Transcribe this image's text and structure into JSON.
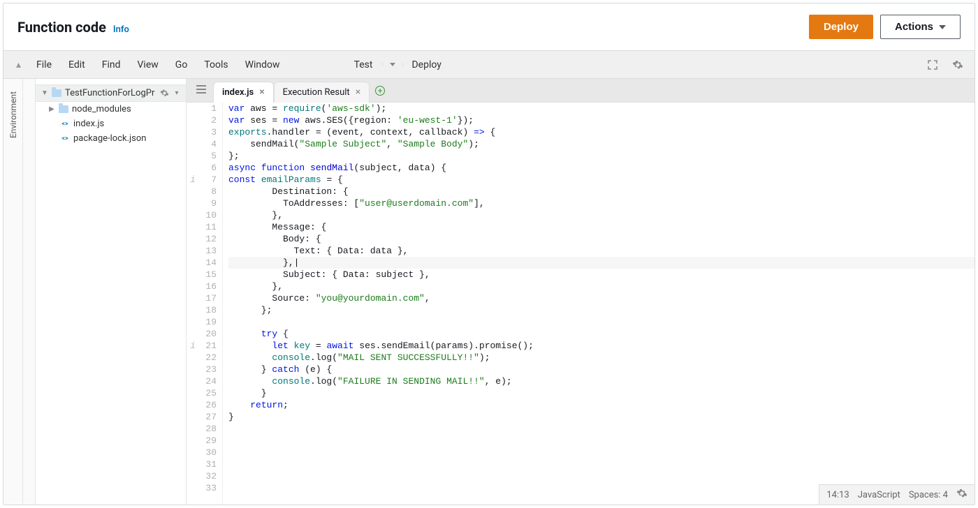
{
  "header": {
    "title": "Function code",
    "info_label": "Info",
    "deploy_label": "Deploy",
    "actions_label": "Actions"
  },
  "menubar": {
    "items": [
      "File",
      "Edit",
      "Find",
      "View",
      "Go",
      "Tools",
      "Window"
    ],
    "test_label": "Test",
    "deploy_label": "Deploy"
  },
  "sidebar": {
    "env_label": "Environment",
    "root": "TestFunctionForLogPr",
    "items": [
      {
        "type": "folder",
        "label": "node_modules"
      },
      {
        "type": "file",
        "label": "index.js"
      },
      {
        "type": "file",
        "label": "package-lock.json"
      }
    ]
  },
  "tabs": [
    {
      "label": "index.js",
      "active": true,
      "closeable": true
    },
    {
      "label": "Execution Result",
      "active": false,
      "closeable": true
    }
  ],
  "code": {
    "info_markers": {
      "7": "i",
      "21": "i"
    },
    "highlighted_line": 14,
    "total_lines": 33,
    "lines": [
      [
        {
          "t": "var",
          "c": "k-blue"
        },
        {
          "t": " aws = "
        },
        {
          "t": "require",
          "c": "k-teal"
        },
        {
          "t": "("
        },
        {
          "t": "'aws-sdk'",
          "c": "k-green"
        },
        {
          "t": ");"
        }
      ],
      [
        {
          "t": "var",
          "c": "k-blue"
        },
        {
          "t": " ses = "
        },
        {
          "t": "new",
          "c": "k-blue"
        },
        {
          "t": " aws.SES({region: "
        },
        {
          "t": "'eu-west-1'",
          "c": "k-green"
        },
        {
          "t": "});"
        }
      ],
      [
        {
          "t": "exports",
          "c": "k-teal"
        },
        {
          "t": ".handler = (event, context, callback) "
        },
        {
          "t": "=>",
          "c": "k-blue"
        },
        {
          "t": " {"
        }
      ],
      [
        {
          "t": "    sendMail("
        },
        {
          "t": "\"Sample Subject\"",
          "c": "k-green"
        },
        {
          "t": ", "
        },
        {
          "t": "\"Sample Body\"",
          "c": "k-green"
        },
        {
          "t": ");"
        }
      ],
      [
        {
          "t": "};"
        }
      ],
      [
        {
          "t": "async",
          "c": "k-blue"
        },
        {
          "t": " "
        },
        {
          "t": "function",
          "c": "k-blue"
        },
        {
          "t": " "
        },
        {
          "t": "sendMail",
          "c": "k-darkblue"
        },
        {
          "t": "(subject, data) {"
        }
      ],
      [
        {
          "t": "const",
          "c": "k-blue"
        },
        {
          "t": " "
        },
        {
          "t": "emailParams",
          "c": "k-teal"
        },
        {
          "t": " = {"
        }
      ],
      [
        {
          "t": "        Destination: {"
        }
      ],
      [
        {
          "t": "          ToAddresses: ["
        },
        {
          "t": "\"user@userdomain.com\"",
          "c": "k-green"
        },
        {
          "t": "],"
        }
      ],
      [
        {
          "t": "        },"
        }
      ],
      [
        {
          "t": "        Message: {"
        }
      ],
      [
        {
          "t": "          Body: {"
        }
      ],
      [
        {
          "t": "            Text: { Data: data },"
        }
      ],
      [
        {
          "t": "          },|"
        }
      ],
      [
        {
          "t": "          Subject: { Data: subject },"
        }
      ],
      [
        {
          "t": "        },"
        }
      ],
      [
        {
          "t": "        Source: "
        },
        {
          "t": "\"you@yourdomain.com\"",
          "c": "k-green"
        },
        {
          "t": ","
        }
      ],
      [
        {
          "t": "      };"
        }
      ],
      [
        {
          "t": ""
        }
      ],
      [
        {
          "t": "      "
        },
        {
          "t": "try",
          "c": "k-blue"
        },
        {
          "t": " {"
        }
      ],
      [
        {
          "t": "        "
        },
        {
          "t": "let",
          "c": "k-blue"
        },
        {
          "t": " "
        },
        {
          "t": "key",
          "c": "k-teal"
        },
        {
          "t": " = "
        },
        {
          "t": "await",
          "c": "k-blue"
        },
        {
          "t": " ses.sendEmail(params).promise();"
        }
      ],
      [
        {
          "t": "        "
        },
        {
          "t": "console",
          "c": "k-teal"
        },
        {
          "t": ".log("
        },
        {
          "t": "\"MAIL SENT SUCCESSFULLY!!\"",
          "c": "k-green"
        },
        {
          "t": ");"
        }
      ],
      [
        {
          "t": "      } "
        },
        {
          "t": "catch",
          "c": "k-blue"
        },
        {
          "t": " (e) {"
        }
      ],
      [
        {
          "t": "        "
        },
        {
          "t": "console",
          "c": "k-teal"
        },
        {
          "t": ".log("
        },
        {
          "t": "\"FAILURE IN SENDING MAIL!!\"",
          "c": "k-green"
        },
        {
          "t": ", e);"
        }
      ],
      [
        {
          "t": "      }"
        }
      ],
      [
        {
          "t": "    "
        },
        {
          "t": "return",
          "c": "k-blue"
        },
        {
          "t": ";"
        }
      ],
      [
        {
          "t": "}"
        }
      ],
      [
        {
          "t": ""
        }
      ],
      [
        {
          "t": ""
        }
      ],
      [
        {
          "t": ""
        }
      ],
      [
        {
          "t": ""
        }
      ],
      [
        {
          "t": ""
        }
      ],
      [
        {
          "t": ""
        }
      ]
    ]
  },
  "statusbar": {
    "cursor": "14:13",
    "language": "JavaScript",
    "spaces": "Spaces: 4"
  }
}
